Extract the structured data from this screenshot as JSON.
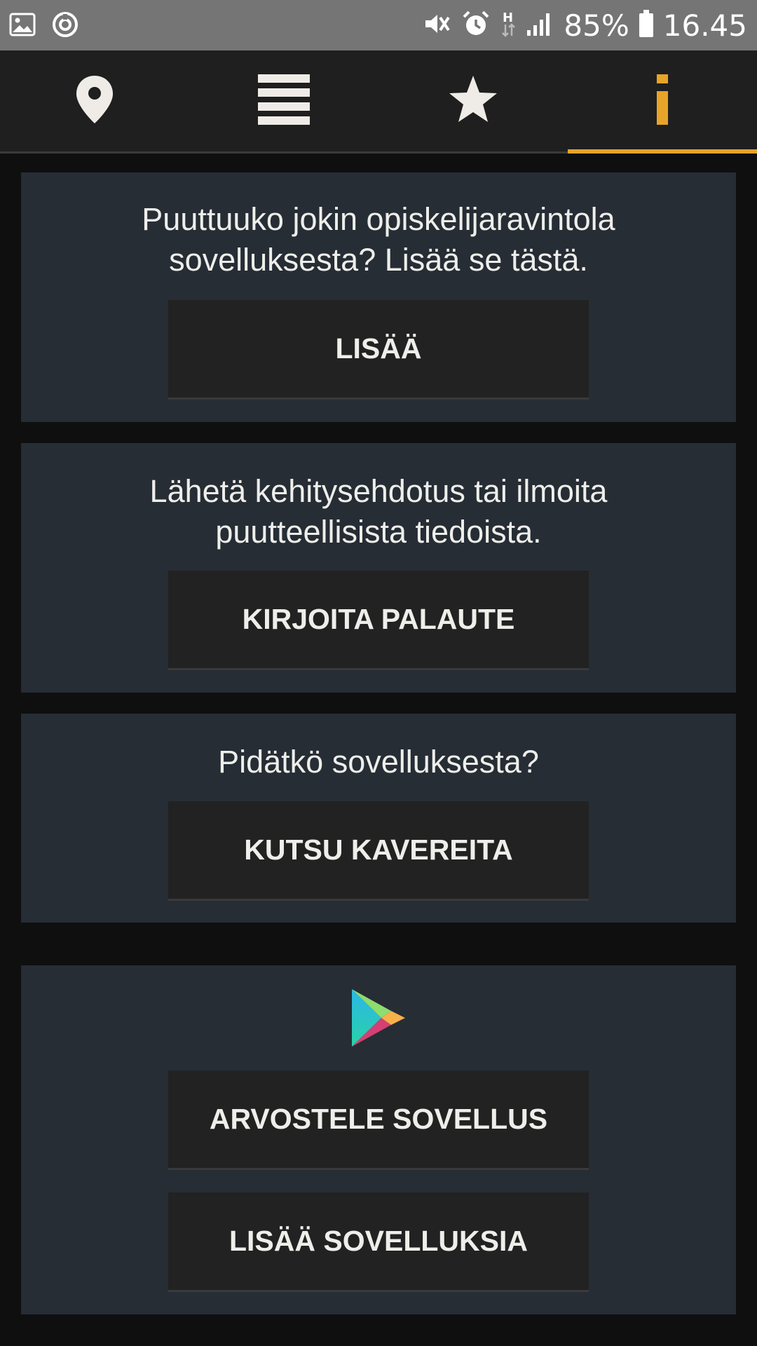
{
  "status_bar": {
    "battery": "85%",
    "time": "16.45",
    "network_label": "H",
    "left_icons": [
      "gallery-icon",
      "sync-icon"
    ],
    "right_icons": [
      "mute-icon",
      "alarm-icon",
      "data-h-icon",
      "signal-icon",
      "battery-icon"
    ]
  },
  "tabs": [
    {
      "icon": "location-pin-icon",
      "active": false
    },
    {
      "icon": "menu-list-icon",
      "active": false
    },
    {
      "icon": "star-icon",
      "active": false
    },
    {
      "icon": "info-icon",
      "active": true
    }
  ],
  "colors": {
    "accent": "#e7a429",
    "card_bg": "#262d35",
    "button_bg": "#222222",
    "page_bg": "#0f0f0f",
    "text": "#eeeeea"
  },
  "cards": {
    "add_restaurant": {
      "text_line1": "Puuttuuko jokin opiskelijaravintola",
      "text_line2": "sovelluksesta? Lisää se tästä.",
      "button": "LISÄÄ"
    },
    "feedback": {
      "text_line1": "Lähetä kehitysehdotus tai ilmoita",
      "text_line2": "puutteellisista tiedoista.",
      "button": "KIRJOITA PALAUTE"
    },
    "invite": {
      "text": "Pidätkö sovelluksesta?",
      "button": "KUTSU KAVEREITA"
    },
    "play_store": {
      "icon": "google-play-icon",
      "button_rate": "ARVOSTELE SOVELLUS",
      "button_more": "LISÄÄ SOVELLUKSIA"
    }
  }
}
